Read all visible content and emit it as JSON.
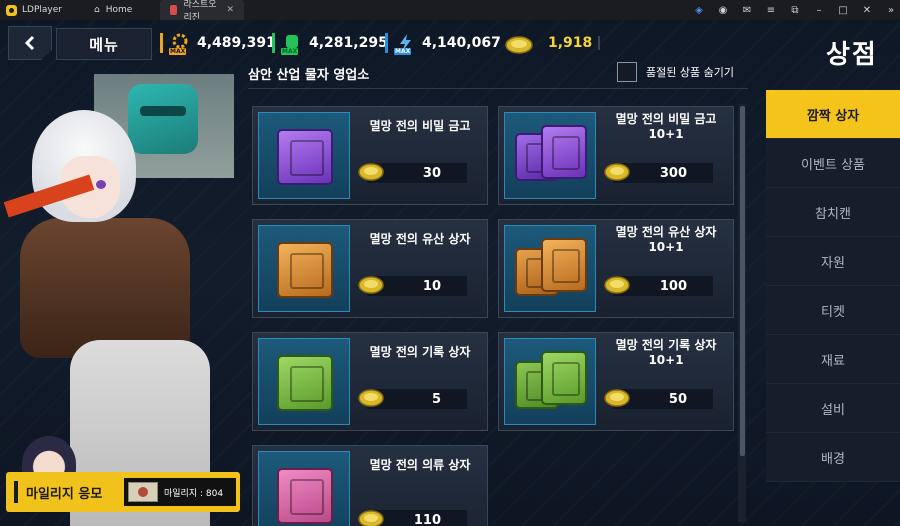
{
  "titlebar": {
    "app_name": "LDPlayer",
    "tabs": [
      {
        "label": "Home",
        "icon": "home-icon"
      },
      {
        "label": "라스트오리진",
        "icon": "game-icon"
      }
    ]
  },
  "header": {
    "menu_label": "메뉴",
    "shop_title": "상점",
    "resources": [
      {
        "name": "parts",
        "value": "4,489,391",
        "icon": "gear-parts-icon",
        "badge": "MAX"
      },
      {
        "name": "nutrients",
        "value": "4,281,295",
        "icon": "nutrient-icon",
        "badge": "MAX"
      },
      {
        "name": "power",
        "value": "4,140,067",
        "icon": "power-icon",
        "badge": "MAX"
      },
      {
        "name": "tuna",
        "value": "1,918",
        "icon": "tuna-icon"
      }
    ]
  },
  "shop": {
    "header": "삼안 산업 물자 영업소",
    "hide_sold_label": "품절된 상품 숨기기",
    "items": [
      {
        "name_line1": "멸망 전의 비밀 금고",
        "name_line2": "",
        "price": "30",
        "color": "#8a4ad8"
      },
      {
        "name_line1": "멸망 전의 비밀 금고",
        "name_line2": "10+1",
        "price": "300",
        "color": "#8a4ad8"
      },
      {
        "name_line1": "멸망 전의 유산 상자",
        "name_line2": "",
        "price": "10",
        "color": "#e09a3a"
      },
      {
        "name_line1": "멸망 전의 유산 상자",
        "name_line2": "10+1",
        "price": "100",
        "color": "#e09a3a"
      },
      {
        "name_line1": "멸망 전의 기록 상자",
        "name_line2": "",
        "price": "5",
        "color": "#7fc44a"
      },
      {
        "name_line1": "멸망 전의 기록 상자",
        "name_line2": "10+1",
        "price": "50",
        "color": "#7fc44a"
      },
      {
        "name_line1": "멸망 전의 의류 상자",
        "name_line2": "",
        "price": "110",
        "color": "#e06aa8"
      }
    ]
  },
  "categories": [
    {
      "label": "깜짝 상자",
      "active": true
    },
    {
      "label": "이벤트 상품",
      "active": false
    },
    {
      "label": "참치캔",
      "active": false
    },
    {
      "label": "자원",
      "active": false
    },
    {
      "label": "티켓",
      "active": false
    },
    {
      "label": "재료",
      "active": false
    },
    {
      "label": "설비",
      "active": false
    },
    {
      "label": "배경",
      "active": false
    }
  ],
  "mileage": {
    "label": "마일리지 응모",
    "points_label": "마일리지 : 804"
  }
}
